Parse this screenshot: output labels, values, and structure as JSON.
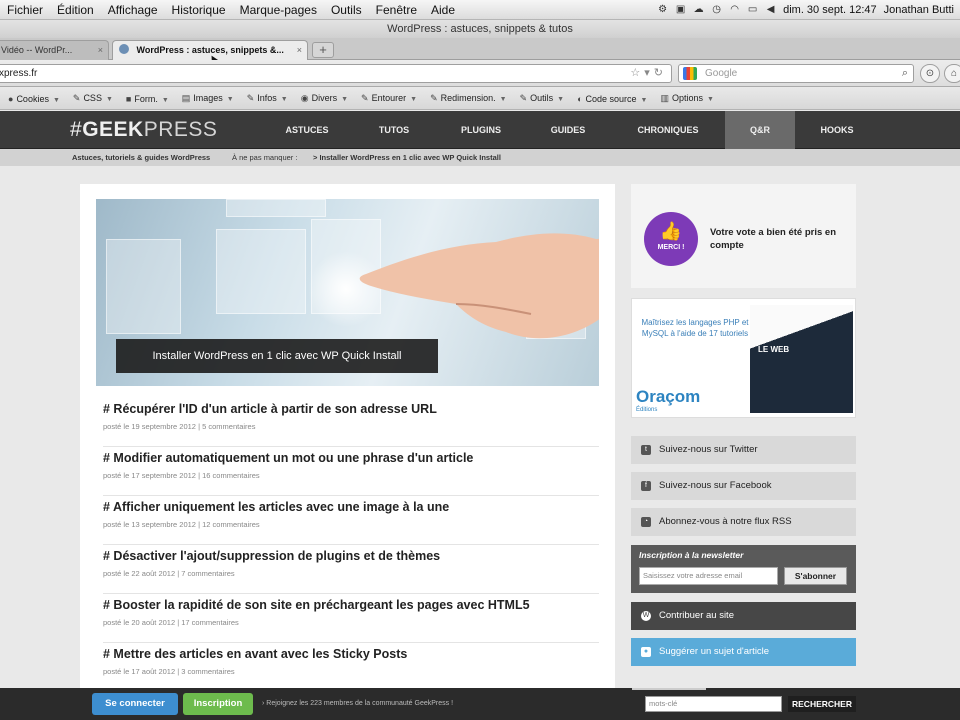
{
  "menubar": {
    "items": [
      "Fichier",
      "Édition",
      "Affichage",
      "Historique",
      "Marque-pages",
      "Outils",
      "Fenêtre",
      "Aide"
    ],
    "datetime": "dim. 30 sept.  12:47",
    "user": "Jonathan Butti"
  },
  "window": {
    "title": "WordPress : astuces, snippets & tutos"
  },
  "tabs": [
    {
      "label": "Vidéo -- WordPr...",
      "close": "×"
    },
    {
      "label": "WordPress : astuces, snippets &...",
      "close": "×"
    }
  ],
  "newtab_label": "+",
  "urlbar": {
    "value": "xpress.fr"
  },
  "search": {
    "placeholder": "Google"
  },
  "devbar": [
    "Cookies",
    "CSS",
    "Form.",
    "Images",
    "Infos",
    "Divers",
    "Entourer",
    "Redimension.",
    "Outils",
    "Code source",
    "Options"
  ],
  "site": {
    "logo_hash": "#",
    "logo_bold": "GEEK",
    "logo_light": "PRESS",
    "nav": [
      "ASTUCES",
      "TUTOS",
      "PLUGINS",
      "GUIDES",
      "CHRONIQUES",
      "Q&R",
      "HOOKS"
    ],
    "breadcrumb": {
      "tagline": "Astuces, tutoriels & guides WordPress",
      "prefix": "À ne pas manquer :",
      "link": "> Installer WordPress en 1 clic avec WP Quick Install"
    },
    "hero_caption": "Installer WordPress en 1 clic avec WP Quick Install",
    "articles": [
      {
        "title": "# Récupérer l'ID d'un article à partir de son adresse URL",
        "meta": "posté le 19 septembre 2012 | 5 commentaires"
      },
      {
        "title": "# Modifier automatiquement un mot ou une phrase d'un article",
        "meta": "posté le 17 septembre 2012 | 16 commentaires"
      },
      {
        "title": "# Afficher uniquement les articles avec une image à la une",
        "meta": "posté le 13 septembre 2012 | 12 commentaires"
      },
      {
        "title": "# Désactiver l'ajout/suppression de plugins et de thèmes",
        "meta": "posté le 22 août 2012 | 7 commentaires"
      },
      {
        "title": "# Booster la rapidité de son site en préchargeant les pages avec HTML5",
        "meta": "posté le 20 août 2012 | 17 commentaires"
      },
      {
        "title": "# Mettre des articles en avant avec les Sticky Posts",
        "meta": "posté le 17 août 2012 | 3 commentaires"
      }
    ],
    "sidebar": {
      "vote_badge": "MERCI !",
      "vote_text": "Votre vote a bien été pris en compte",
      "ad_text": "Maîtrisez les langages PHP et MySQL à l'aide de 17 tutoriels",
      "ad_brand": "Oraçom",
      "ad_brand_sub": "Éditions",
      "ad_book_title": "LE WEB",
      "twitter": "Suivez-nous sur Twitter",
      "facebook": "Suivez-nous sur Facebook",
      "rss": "Abonnez-vous à notre flux RSS",
      "newsletter_title": "Inscription à la newsletter",
      "newsletter_placeholder": "Saisissez votre adresse email",
      "newsletter_button": "S'abonner",
      "contribute": "Contribuer au site",
      "suggest": "Suggérer un sujet d'article"
    },
    "bottombar": {
      "login": "Se connecter",
      "signup": "Inscription",
      "text": "› Rejoignez les 223 membres de la communauté GeekPress !",
      "search_placeholder": "mots-clé",
      "search_button": "RECHERCHER"
    }
  }
}
